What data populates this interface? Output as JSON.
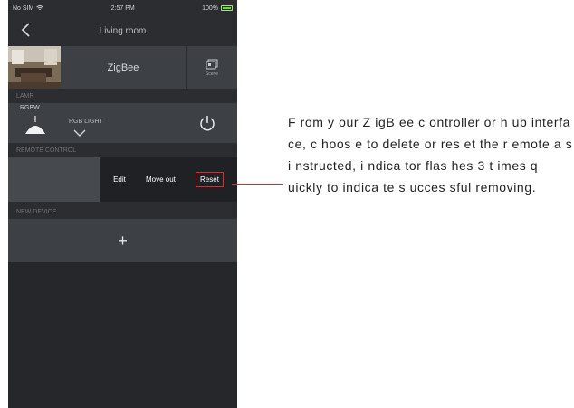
{
  "status_bar": {
    "carrier": "No SIM",
    "time": "2:57 PM",
    "battery": "100%"
  },
  "nav": {
    "title": "Living room"
  },
  "hub": {
    "name": "ZigBee",
    "scene_label": "Scene"
  },
  "sections": {
    "lamp": "LAMP",
    "remote": "REMOTE CONTROL",
    "new_device": "NEW DEVICE"
  },
  "lamp": {
    "type_label": "RGBW",
    "name": "RGB LIGHT"
  },
  "remote": {
    "actions": {
      "edit": "Edit",
      "move_out": "Move out",
      "reset": "Reset"
    }
  },
  "add_device": {
    "symbol": "+"
  },
  "instruction": {
    "text": "F rom y our Z igB ee c ontroller or h ub interfa ce, c hoos e to delete or res et the r emote a s i nstructed, i ndica tor flas hes 3 t imes q uickly to indica te s ucces sful removing."
  },
  "colors": {
    "accent_red": "#e0282e",
    "screen_bg": "#2b2d30",
    "row_bg": "#3d4044"
  },
  "icons": [
    "wifi-icon",
    "battery-icon",
    "back-icon",
    "scene-icon",
    "lamp-icon",
    "chevron-down-icon",
    "power-icon",
    "plus-icon"
  ]
}
